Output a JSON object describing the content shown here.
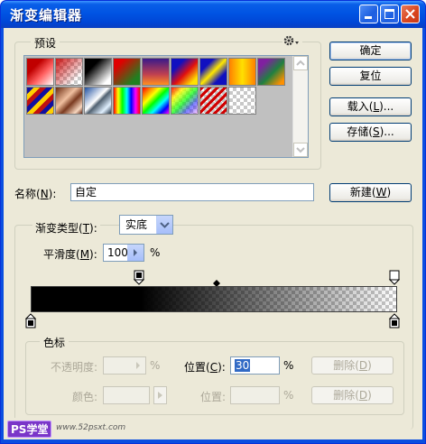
{
  "window": {
    "title": "渐变编辑器"
  },
  "presets": {
    "label": "预设",
    "menu_icon": "gear-icon",
    "swatches": [
      "red-to-transparent",
      "red-checker",
      "black-to-white",
      "red-to-green",
      "violet-to-orange",
      "blue-red-yellow",
      "blue-yellow-blue",
      "orange-yellow-orange",
      "violet-green-orange",
      "yellow-violet-stripes",
      "copper",
      "chrome",
      "rainbow",
      "spectrum-diagonal",
      "transparent-rainbow",
      "transparent-stripes",
      "transparent-checker"
    ]
  },
  "buttons": {
    "ok": "确定",
    "reset": "复位",
    "load_prefix": "载入(",
    "load_key": "L",
    "load_suffix": ")...",
    "save_prefix": "存储(",
    "save_key": "S",
    "save_suffix": ")...",
    "new_prefix": "新建(",
    "new_key": "W",
    "new_suffix": ")"
  },
  "name": {
    "label_prefix": "名称(",
    "label_key": "N",
    "label_suffix": "):",
    "value": "自定"
  },
  "gradient": {
    "type_prefix": "渐变类型(",
    "type_key": "T",
    "type_suffix": "):",
    "type_value": "实底",
    "smooth_prefix": "平滑度(",
    "smooth_key": "M",
    "smooth_suffix": "):",
    "smooth_value": "100",
    "smooth_unit": "%"
  },
  "stops": {
    "label": "色标",
    "opacity_label": "不透明度:",
    "opacity_unit": "%",
    "location_prefix": "位置(",
    "location_key": "C",
    "location_suffix": "):",
    "location_value": "30",
    "location_unit": "%",
    "delete_prefix": "删除(",
    "delete_key": "D",
    "delete_suffix": ")",
    "color_label": "颜色:",
    "location2_label": "位置:",
    "location2_unit": "%",
    "delete2_prefix": "删除(",
    "delete2_key": "D",
    "delete2_suffix": ")"
  },
  "watermark": {
    "logo": "PS学堂",
    "url": "www.52psxt.com"
  },
  "colors": {
    "title_bar": "#0054e3",
    "dialog_bg": "#ece9d8",
    "button_border": "#003c74",
    "selection": "#316ac5"
  }
}
